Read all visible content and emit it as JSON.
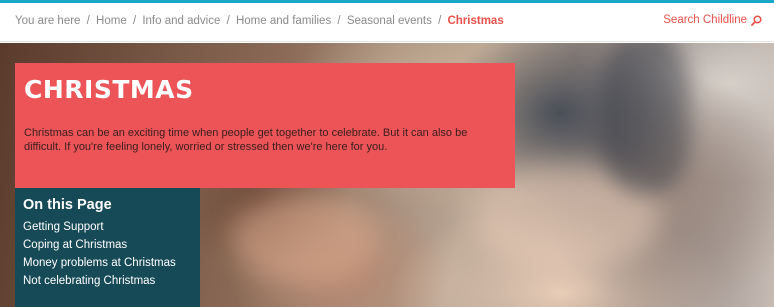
{
  "breadcrumb": {
    "prefix": "You are here",
    "separator": "/",
    "items": [
      "Home",
      "Info and advice",
      "Home and families",
      "Seasonal events"
    ],
    "current": "Christmas"
  },
  "search": {
    "label": "Search Childline",
    "icon": "search-icon"
  },
  "hero": {
    "title": "CHRISTMAS",
    "intro": "Christmas can be an exciting time when people get together to celebrate. But it can also be difficult. If you're feeling lonely, worried or stressed then we're here for you."
  },
  "toc": {
    "title": "On this Page",
    "items": [
      "Getting Support",
      "Coping at Christmas",
      "Money problems at Christmas",
      "Not celebrating Christmas"
    ]
  },
  "colors": {
    "accent_red": "#ec5457",
    "link_red": "#e9504a",
    "toc_bg": "#174a57",
    "top_line": "#1aa6c8"
  }
}
